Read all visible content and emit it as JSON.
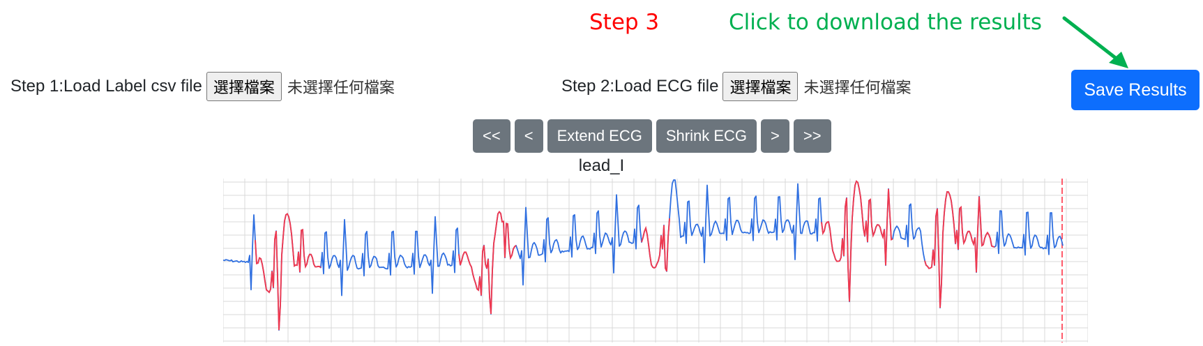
{
  "annotations": {
    "step3": "Step 3",
    "click_hint": "Click to download the results",
    "step3_color": "#ff0000",
    "hint_color": "#00b050"
  },
  "label_loader": {
    "label": "Step 1:Load Label csv file",
    "button": "選擇檔案",
    "status": "未選擇任何檔案"
  },
  "ecg_loader": {
    "label": "Step 2:Load ECG file",
    "button": "選擇檔案",
    "status": "未選擇任何檔案"
  },
  "save_button": {
    "label": "Save Results",
    "color": "#0d6efd"
  },
  "nav": {
    "first": "<<",
    "prev": "<",
    "extend": "Extend ECG",
    "shrink": "Shrink ECG",
    "next": ">",
    "last": ">>"
  },
  "chart_data": {
    "type": "line",
    "title": "lead_I",
    "grid": true,
    "colors": {
      "normal": "#2f6fe0",
      "labeled": "#f0394f",
      "marker": "#ff5a6a",
      "grid": "#d9d9d9"
    }
  }
}
